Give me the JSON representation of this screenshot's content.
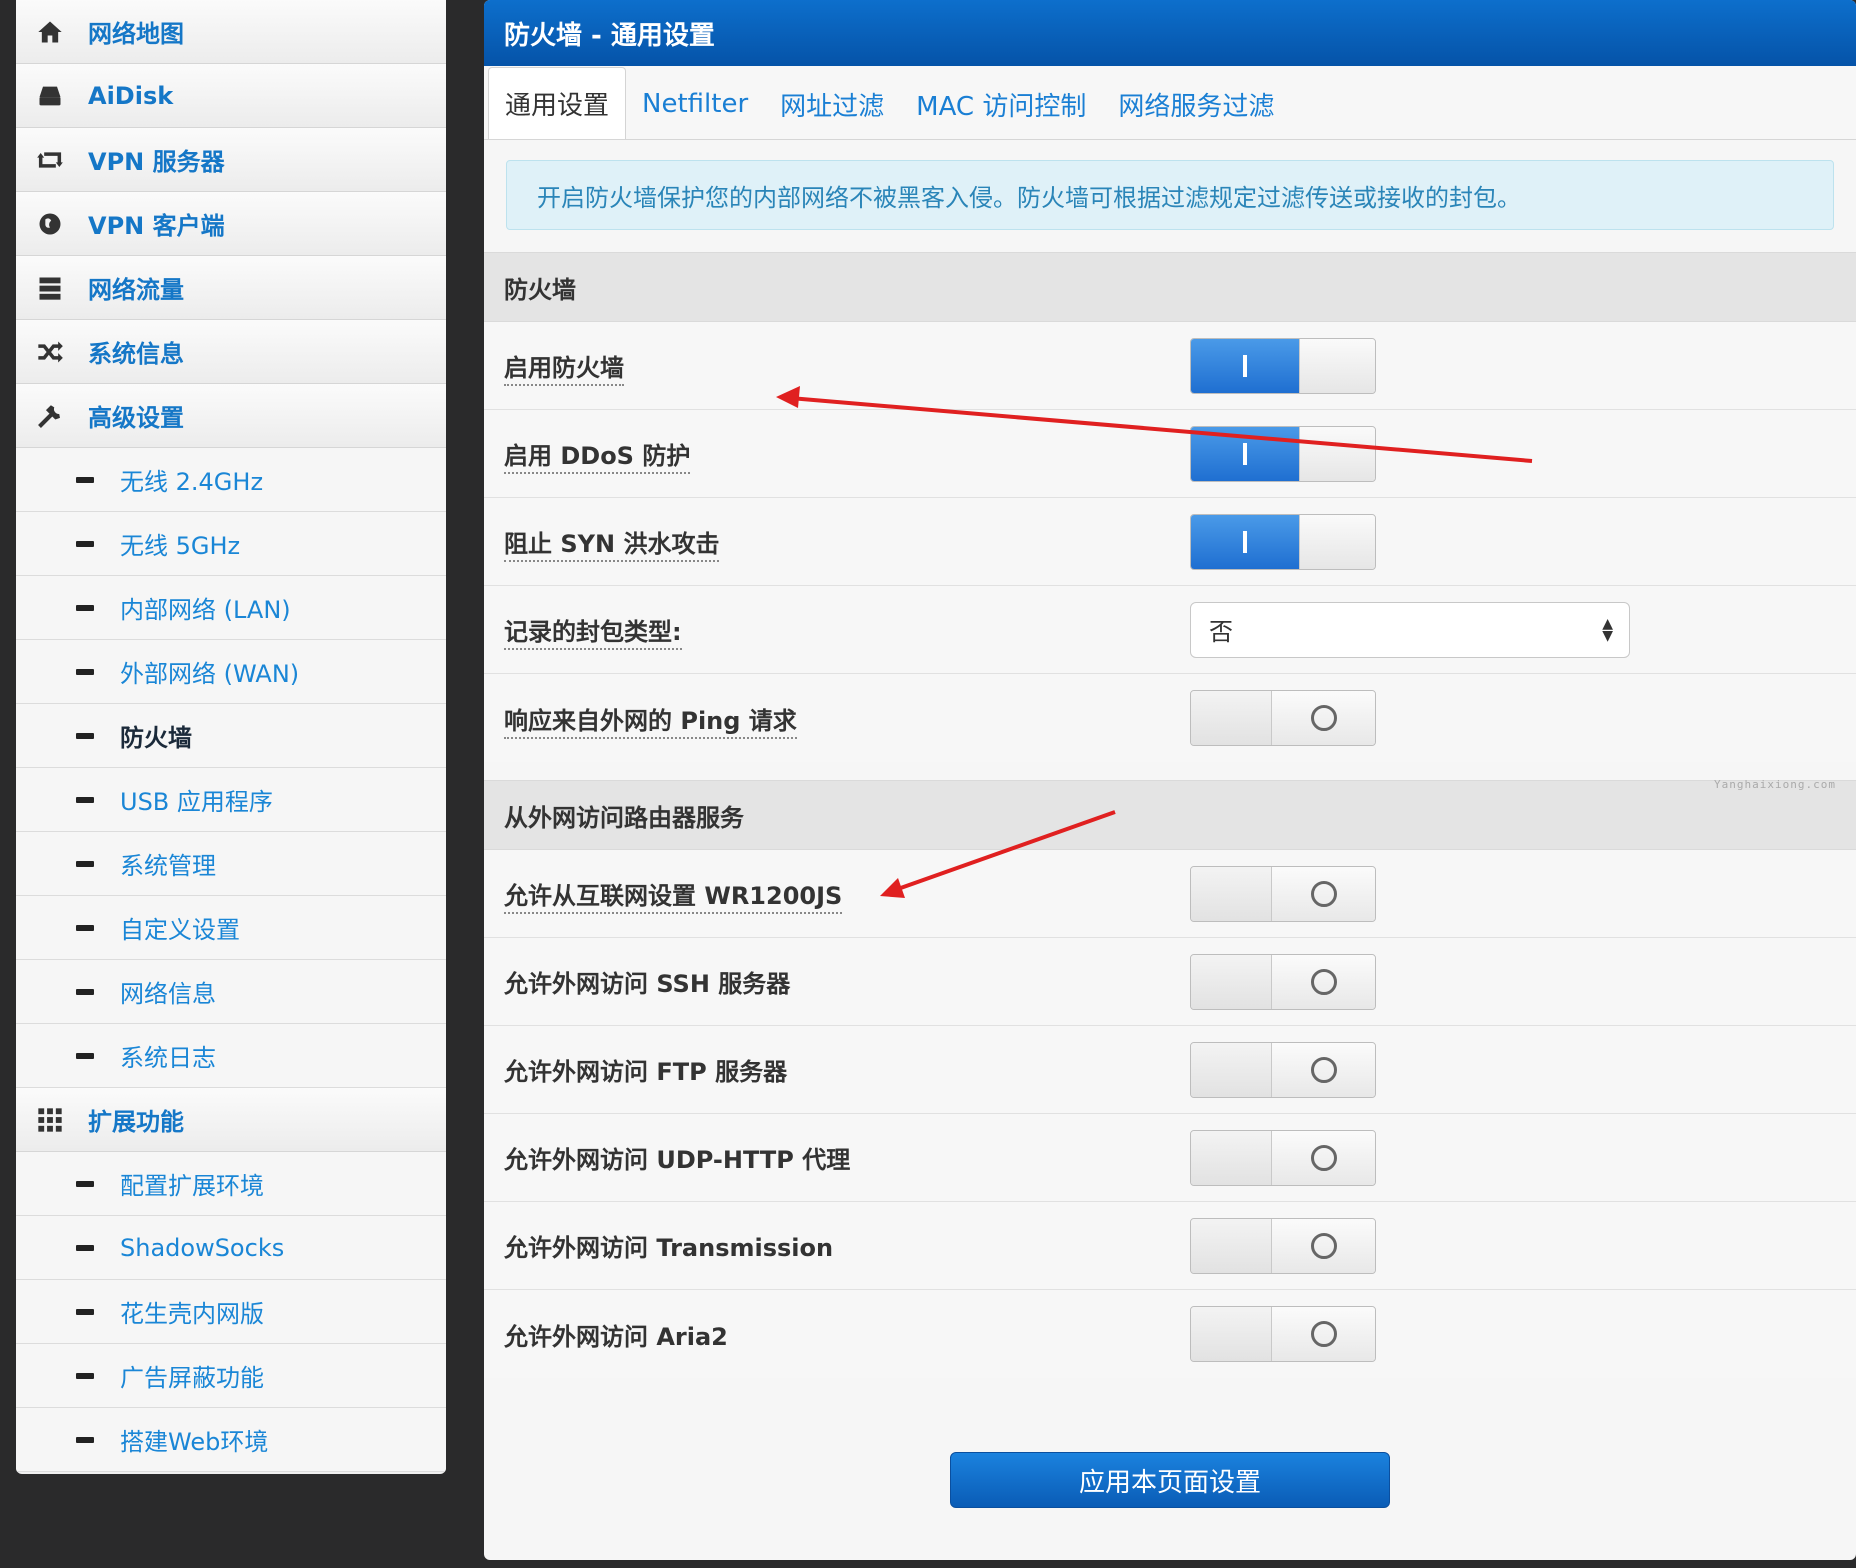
{
  "sidebar": {
    "items": [
      {
        "label": "网络地图",
        "icon": "home-icon"
      },
      {
        "label": "AiDisk",
        "icon": "disk-icon"
      },
      {
        "label": "VPN 服务器",
        "icon": "retweet-icon"
      },
      {
        "label": "VPN 客户端",
        "icon": "globe-icon"
      },
      {
        "label": "网络流量",
        "icon": "server-icon"
      },
      {
        "label": "系统信息",
        "icon": "random-icon"
      },
      {
        "label": "高级设置",
        "icon": "wrench-icon"
      }
    ],
    "advanced_sub": [
      "无线 2.4GHz",
      "无线 5GHz",
      "内部网络 (LAN)",
      "外部网络 (WAN)",
      "防火墙",
      "USB 应用程序",
      "系统管理",
      "自定义设置",
      "网络信息",
      "系统日志"
    ],
    "ext_header": {
      "label": "扩展功能",
      "icon": "grid-icon"
    },
    "ext_sub": [
      "配置扩展环境",
      "ShadowSocks",
      "花生壳内网版",
      "广告屏蔽功能",
      "搭建Web环境"
    ]
  },
  "main": {
    "title": "防火墙 - 通用设置",
    "tabs": [
      "通用设置",
      "Netfilter",
      "网址过滤",
      "MAC 访问控制",
      "网络服务过滤"
    ],
    "info": "开启防火墙保护您的内部网络不被黑客入侵。防火墙可根据过滤规定过滤传送或接收的封包。",
    "section1": {
      "title": "防火墙",
      "rows": [
        {
          "label": "启用防火墙",
          "state": "on"
        },
        {
          "label": "启用 DDoS 防护",
          "state": "on"
        },
        {
          "label": "阻止 SYN 洪水攻击",
          "state": "on"
        },
        {
          "label": "记录的封包类型:",
          "select": "否"
        },
        {
          "label": "响应来自外网的 Ping 请求",
          "state": "off"
        }
      ]
    },
    "watermark": "Yanghaixiong.com",
    "section2": {
      "title": "从外网访问路由器服务",
      "rows": [
        {
          "label": "允许从互联网设置 WR1200JS",
          "state": "off"
        },
        {
          "label": "允许外网访问 SSH 服务器",
          "state": "off"
        },
        {
          "label": "允许外网访问 FTP 服务器",
          "state": "off"
        },
        {
          "label": "允许外网访问 UDP-HTTP 代理",
          "state": "off"
        },
        {
          "label": "允许外网访问 Transmission",
          "state": "off"
        },
        {
          "label": "允许外网访问 Aria2",
          "state": "off"
        }
      ]
    },
    "apply_label": "应用本页面设置"
  },
  "colors": {
    "accent": "#1577c7",
    "title_bar": "#0a62bf",
    "toggle_on": "#2f82dc",
    "annotation_arrow": "#e02020"
  }
}
